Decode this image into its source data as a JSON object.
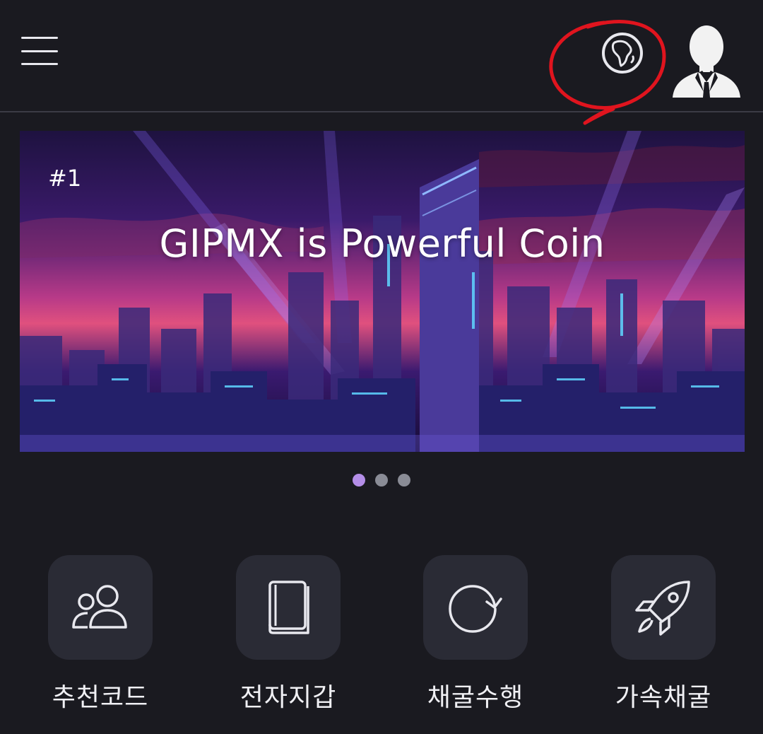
{
  "header": {
    "menu_icon": "hamburger-menu-icon",
    "language_icon": "globe-icon",
    "profile_icon": "avatar-silhouette",
    "annotation_color": "#e0141e"
  },
  "banner": {
    "tag": "#1",
    "title": "GIPMX is Powerful Coin"
  },
  "carousel": {
    "count": 3,
    "active_index": 0,
    "active_color": "#b48ee8",
    "inactive_color": "#8a8c96"
  },
  "quick_menu": [
    {
      "label": "추천코드",
      "icon": "users-icon"
    },
    {
      "label": "전자지갑",
      "icon": "book-icon"
    },
    {
      "label": "채굴수행",
      "icon": "refresh-icon"
    },
    {
      "label": "가속채굴",
      "icon": "rocket-icon"
    }
  ]
}
